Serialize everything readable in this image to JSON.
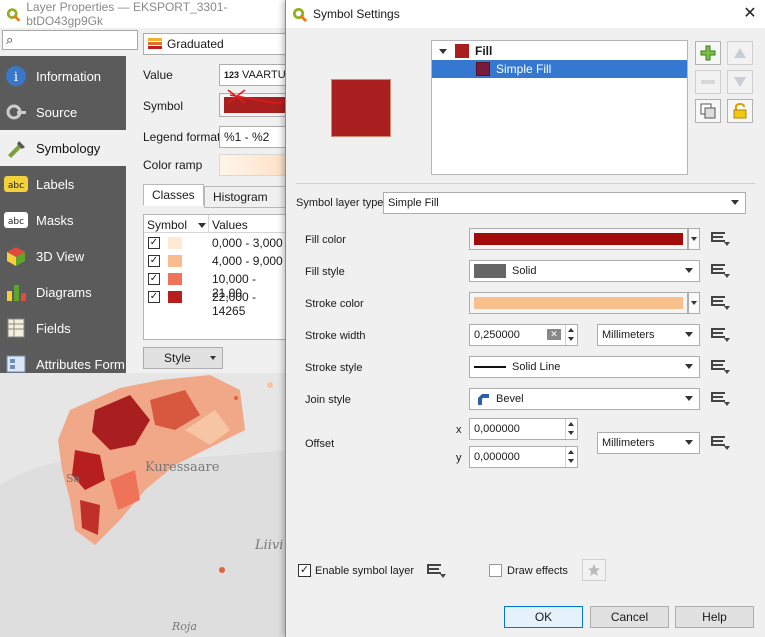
{
  "layer_props": {
    "title": "Layer Properties — EKSPORT_3301-btDO43gp9Gk",
    "search_icon": "search-icon",
    "nav": [
      {
        "label": "Information",
        "icon": "info-icon"
      },
      {
        "label": "Source",
        "icon": "source-icon"
      },
      {
        "label": "Symbology",
        "icon": "brush-icon"
      },
      {
        "label": "Labels",
        "icon": "labels-icon"
      },
      {
        "label": "Masks",
        "icon": "masks-icon"
      },
      {
        "label": "3D View",
        "icon": "cube-icon"
      },
      {
        "label": "Diagrams",
        "icon": "diagrams-icon"
      },
      {
        "label": "Fields",
        "icon": "fields-icon"
      },
      {
        "label": "Attributes Form",
        "icon": "form-icon"
      }
    ],
    "renderer": "Graduated",
    "value_label": "Value",
    "value_field": "VAARTUS",
    "value_field_type": "123",
    "symbol_label": "Symbol",
    "legend_format_label": "Legend format",
    "legend_format": "%1 - %2",
    "color_ramp_label": "Color ramp",
    "tabs": [
      "Classes",
      "Histogram"
    ],
    "table_headers": [
      "Symbol",
      "Values"
    ],
    "classes": [
      {
        "value": "0,000 - 3,000",
        "color": "#fde9d4"
      },
      {
        "value": "4,000 - 9,000",
        "color": "#f9bd8d"
      },
      {
        "value": "10,000 - 21,00",
        "color": "#ee7358"
      },
      {
        "value": "22,000 - 14265",
        "color": "#b71e1e"
      }
    ],
    "style_button": "Style"
  },
  "map": {
    "labels": [
      "Kuressaare",
      "Sa",
      "Liivi",
      "Roja"
    ]
  },
  "dialog": {
    "title": "Symbol Settings",
    "tree": {
      "root": "Fill",
      "child": "Simple Fill",
      "root_color": "#a91f1f",
      "child_color": "#7a1a3a"
    },
    "symbol_layer_type_label": "Symbol layer type",
    "symbol_layer_type": "Simple Fill",
    "fields": {
      "fill_color_label": "Fill color",
      "fill_color": "#a30a0a",
      "fill_style_label": "Fill style",
      "fill_style": "Solid",
      "stroke_color_label": "Stroke color",
      "stroke_color": "#f9c08e",
      "stroke_width_label": "Stroke width",
      "stroke_width": "0,250000",
      "stroke_width_unit": "Millimeters",
      "stroke_style_label": "Stroke style",
      "stroke_style": "Solid Line",
      "join_style_label": "Join style",
      "join_style": "Bevel",
      "offset_label": "Offset",
      "offset_x_label": "x",
      "offset_x": "0,000000",
      "offset_y_label": "y",
      "offset_y": "0,000000",
      "offset_unit": "Millimeters"
    },
    "enable_symbol_layer": "Enable symbol layer",
    "draw_effects": "Draw effects",
    "buttons": {
      "ok": "OK",
      "cancel": "Cancel",
      "help": "Help"
    }
  }
}
